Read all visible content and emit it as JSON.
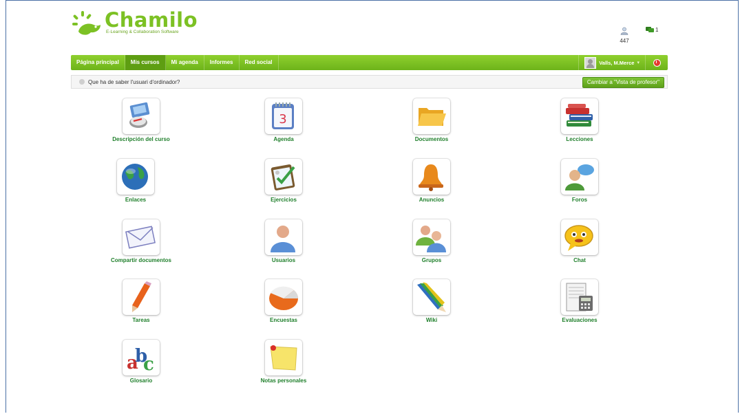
{
  "brand": {
    "name": "Chamilo",
    "tagline": "E-Learning & Collaboration Software",
    "colors": {
      "primary": "#7cc124",
      "nav": "#6db31a",
      "tool_label": "#1f7f2b"
    }
  },
  "header": {
    "users_online_count": "447",
    "chat_count": "1"
  },
  "nav": {
    "items": [
      {
        "label": "Página principal",
        "active": false
      },
      {
        "label": "Mis cursos",
        "active": true
      },
      {
        "label": "Mi agenda",
        "active": false
      },
      {
        "label": "Informes",
        "active": false
      },
      {
        "label": "Red social",
        "active": false
      }
    ],
    "user_name": "Valls, M.Merce",
    "user_caret": "▾"
  },
  "subbar": {
    "text": "Que ha de saber l'usuari d'ordinador?",
    "switch_button": "Cambiar a \"Vista de profesor\""
  },
  "tools": [
    {
      "label": "Descripción del curso",
      "icon": "course-description-icon"
    },
    {
      "label": "Agenda",
      "icon": "calendar-icon"
    },
    {
      "label": "Documentos",
      "icon": "folder-icon"
    },
    {
      "label": "Lecciones",
      "icon": "books-icon"
    },
    {
      "label": "Enlaces",
      "icon": "globe-icon"
    },
    {
      "label": "Ejercicios",
      "icon": "exercise-check-icon"
    },
    {
      "label": "Anuncios",
      "icon": "bell-icon"
    },
    {
      "label": "Foros",
      "icon": "forum-icon"
    },
    {
      "label": "Compartir documentos",
      "icon": "envelope-icon"
    },
    {
      "label": "Usuarios",
      "icon": "user-icon"
    },
    {
      "label": "Grupos",
      "icon": "group-icon"
    },
    {
      "label": "Chat",
      "icon": "chat-icon"
    },
    {
      "label": "Tareas",
      "icon": "pencil-icon"
    },
    {
      "label": "Encuestas",
      "icon": "survey-pie-icon"
    },
    {
      "label": "Wiki",
      "icon": "wiki-pencils-icon"
    },
    {
      "label": "Evaluaciones",
      "icon": "gradebook-icon"
    },
    {
      "label": "Glosario",
      "icon": "glossary-abc-icon"
    },
    {
      "label": "Notas personales",
      "icon": "note-icon"
    }
  ]
}
